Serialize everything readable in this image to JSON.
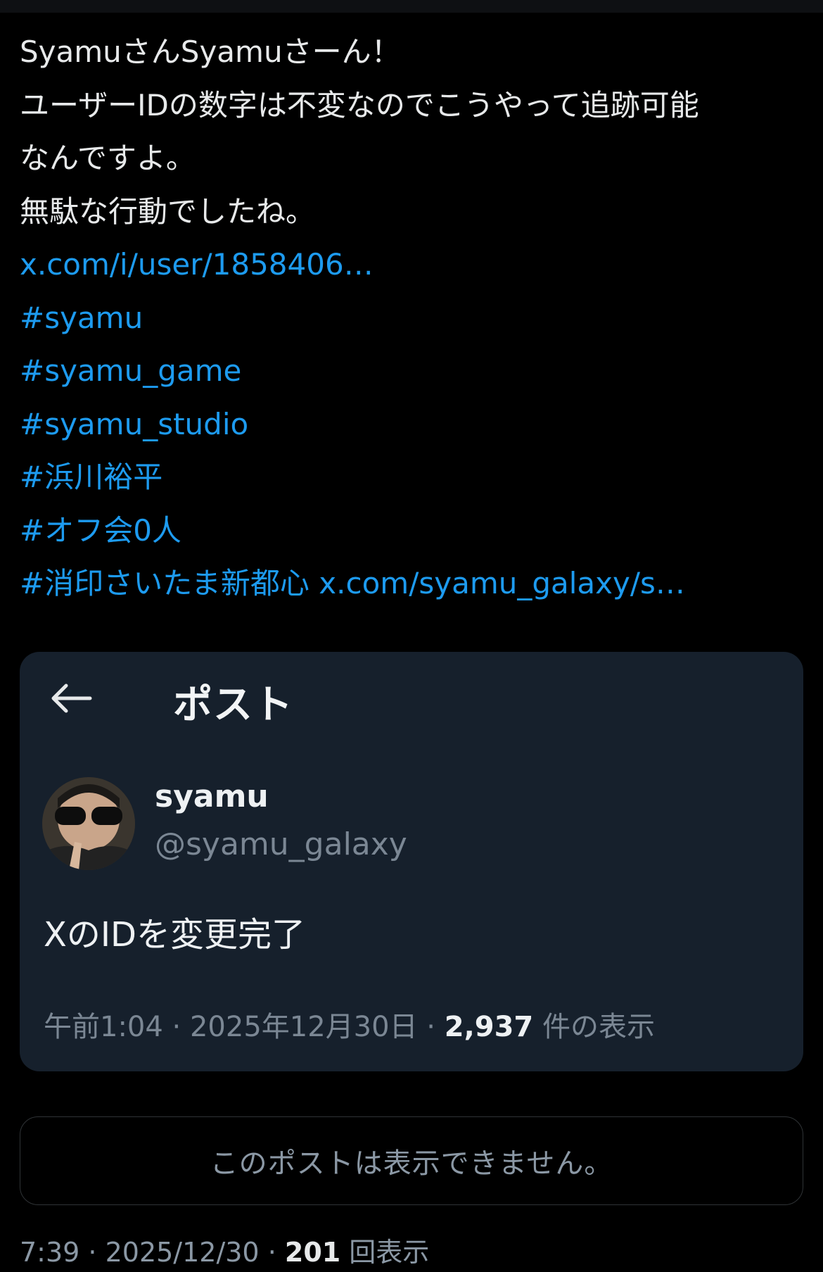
{
  "tweet": {
    "lines": [
      "SyamuさんSyamuさーん！",
      "ユーザーIDの数字は不変なのでこうやって追跡可能",
      "なんですよ。",
      "無駄な行動でしたね。"
    ],
    "links": [
      "x.com/i/user/1858406…",
      "#syamu",
      "#syamu_game",
      "#syamu_studio",
      "#浜川裕平",
      "#オフ会0人"
    ],
    "last_hashtag": "#消印さいたま新都心",
    "last_url": "x.com/syamu_galaxy/s…"
  },
  "quote": {
    "back_icon": "left-arrow-icon",
    "header_title": "ポスト",
    "display_name": "syamu",
    "handle": "@syamu_galaxy",
    "body": "XのIDを変更完了",
    "time": "午前1:04",
    "sep1": " · ",
    "date": "2025年12月30日",
    "sep2": " · ",
    "views": "2,937",
    "views_suffix": " 件の表示"
  },
  "unavailable_notice": "このポストは表示できません。",
  "post_meta": {
    "time": "7:39",
    "sep1": " · ",
    "date": "2025/12/30",
    "sep2": " · ",
    "views": "201",
    "views_suffix": " 回表示"
  },
  "colors": {
    "background": "#000000",
    "link": "#1d9bf0",
    "card": "#16202c",
    "muted": "#8b98a5"
  }
}
